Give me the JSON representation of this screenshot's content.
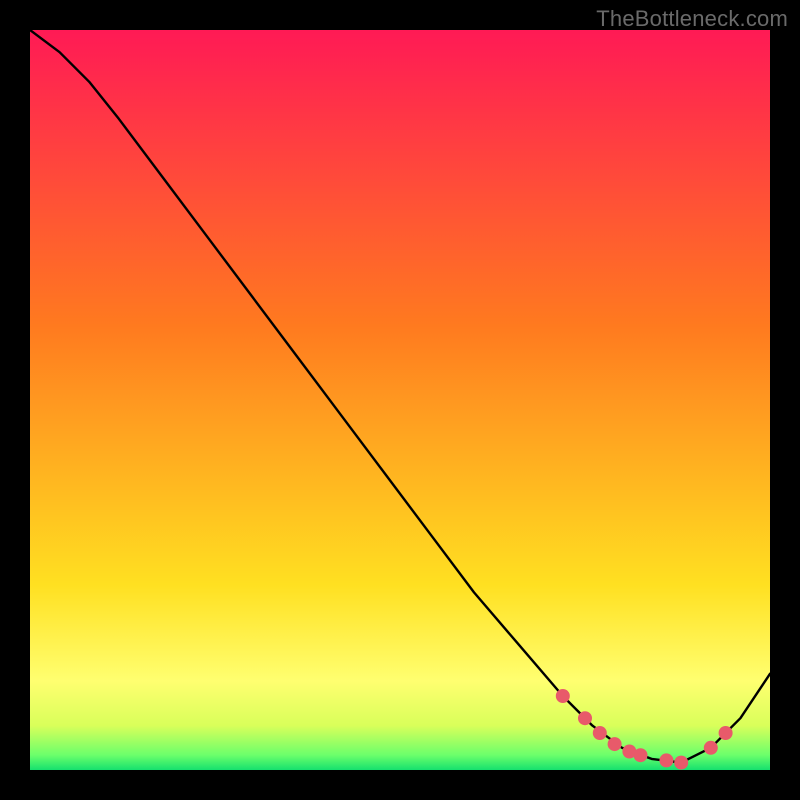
{
  "watermark": "TheBottleneck.com",
  "chart_data": {
    "type": "line",
    "title": "",
    "xlabel": "",
    "ylabel": "",
    "xlim": [
      0,
      100
    ],
    "ylim": [
      0,
      100
    ],
    "series": [
      {
        "name": "curve",
        "x": [
          0,
          4,
          8,
          12,
          18,
          24,
          30,
          36,
          42,
          48,
          54,
          60,
          66,
          72,
          76,
          80,
          84,
          88,
          92,
          96,
          100
        ],
        "y": [
          100,
          97,
          93,
          88,
          80,
          72,
          64,
          56,
          48,
          40,
          32,
          24,
          17,
          10,
          6,
          3,
          1.5,
          1,
          3,
          7,
          13
        ]
      }
    ],
    "markers": {
      "name": "highlight-dots",
      "x": [
        72,
        75,
        77,
        79,
        81,
        82.5,
        86,
        88,
        92,
        94
      ],
      "y": [
        10,
        7,
        5,
        3.5,
        2.5,
        2,
        1.3,
        1,
        3,
        5
      ]
    },
    "gradient_bands": [
      {
        "y0": 100,
        "y1": 60,
        "c0": "#ff1a55",
        "c1": "#ff7a1f"
      },
      {
        "y0": 60,
        "y1": 25,
        "c0": "#ff7a1f",
        "c1": "#ffe021"
      },
      {
        "y0": 25,
        "y1": 12,
        "c0": "#ffe021",
        "c1": "#ffff70"
      },
      {
        "y0": 12,
        "y1": 6,
        "c0": "#ffff70",
        "c1": "#d9ff5a"
      },
      {
        "y0": 6,
        "y1": 2,
        "c0": "#d9ff5a",
        "c1": "#6bff6b"
      },
      {
        "y0": 2,
        "y1": 0,
        "c0": "#6bff6b",
        "c1": "#15e06e"
      }
    ],
    "marker_color": "#e85a6a"
  }
}
